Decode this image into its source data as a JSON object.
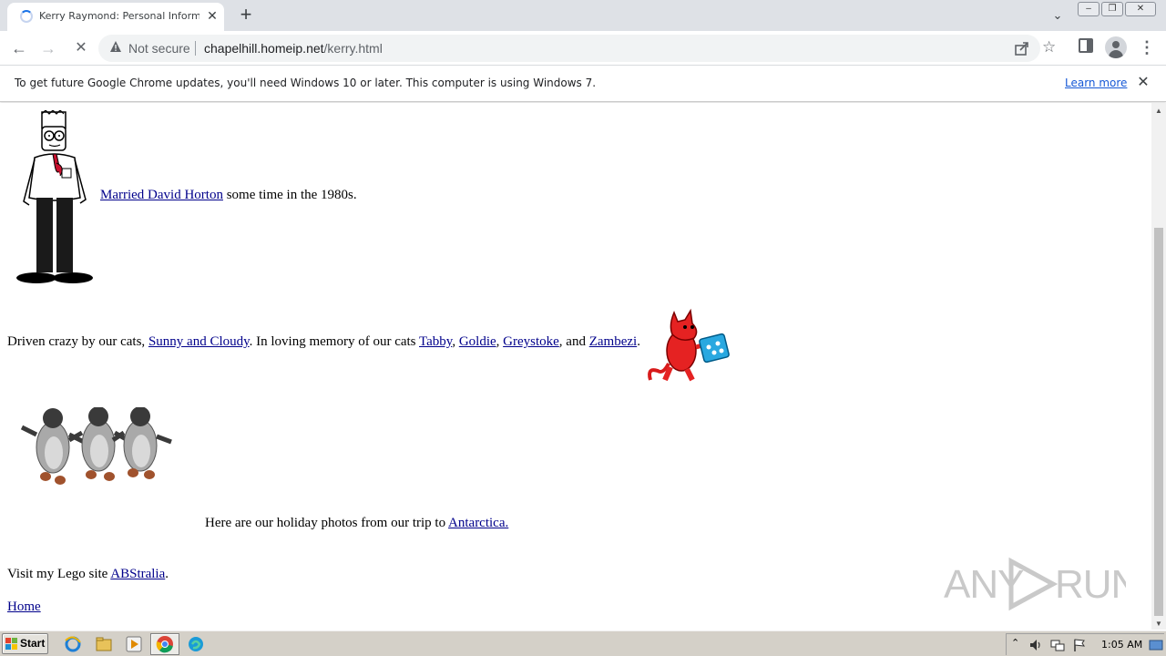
{
  "browser": {
    "tab_title": "Kerry Raymond: Personal Information",
    "tab_close": "✕",
    "new_tab": "+",
    "tab_search": "⌄",
    "window_buttons": {
      "minimize": "–",
      "maximize": "❐",
      "close": "✕"
    },
    "nav": {
      "back": "←",
      "forward": "→",
      "reload": "✕"
    },
    "security_label": "Not secure",
    "url_host": "chapelhill.homeip.net",
    "url_path": "/kerry.html",
    "star": "☆",
    "menu": "⋮"
  },
  "infobar": {
    "message": "To get future Google Chrome updates, you'll need Windows 10 or later. This computer is using Windows 7.",
    "learn_more": "Learn more",
    "close": "✕"
  },
  "page": {
    "married": {
      "link": "Married David Horton",
      "rest": " some time in the 1980s."
    },
    "cats": {
      "intro": "Driven crazy by our cats, ",
      "sunny_cloudy": "Sunny and Cloudy",
      "memory": ". In loving memory of our cats ",
      "tabby": "Tabby",
      "sep1": ", ",
      "goldie": "Goldie",
      "sep2": ", ",
      "greystoke": "Greystoke",
      "and": ", and ",
      "zambezi": "Zambezi",
      "end": "."
    },
    "antarctica": {
      "text": "Here are our holiday photos from our trip to ",
      "link": "Antarctica."
    },
    "lego": {
      "text": "Visit my Lego site ",
      "link": "ABStralia",
      "end": "."
    },
    "home": "Home"
  },
  "watermark": "ANY RUN",
  "taskbar": {
    "start": "Start",
    "clock": "1:05 AM"
  },
  "colors": {
    "link": "#00008b",
    "tabstrip": "#dee1e6",
    "taskbar": "#d4d0c8",
    "chrome_accent": "#1a73e8"
  }
}
